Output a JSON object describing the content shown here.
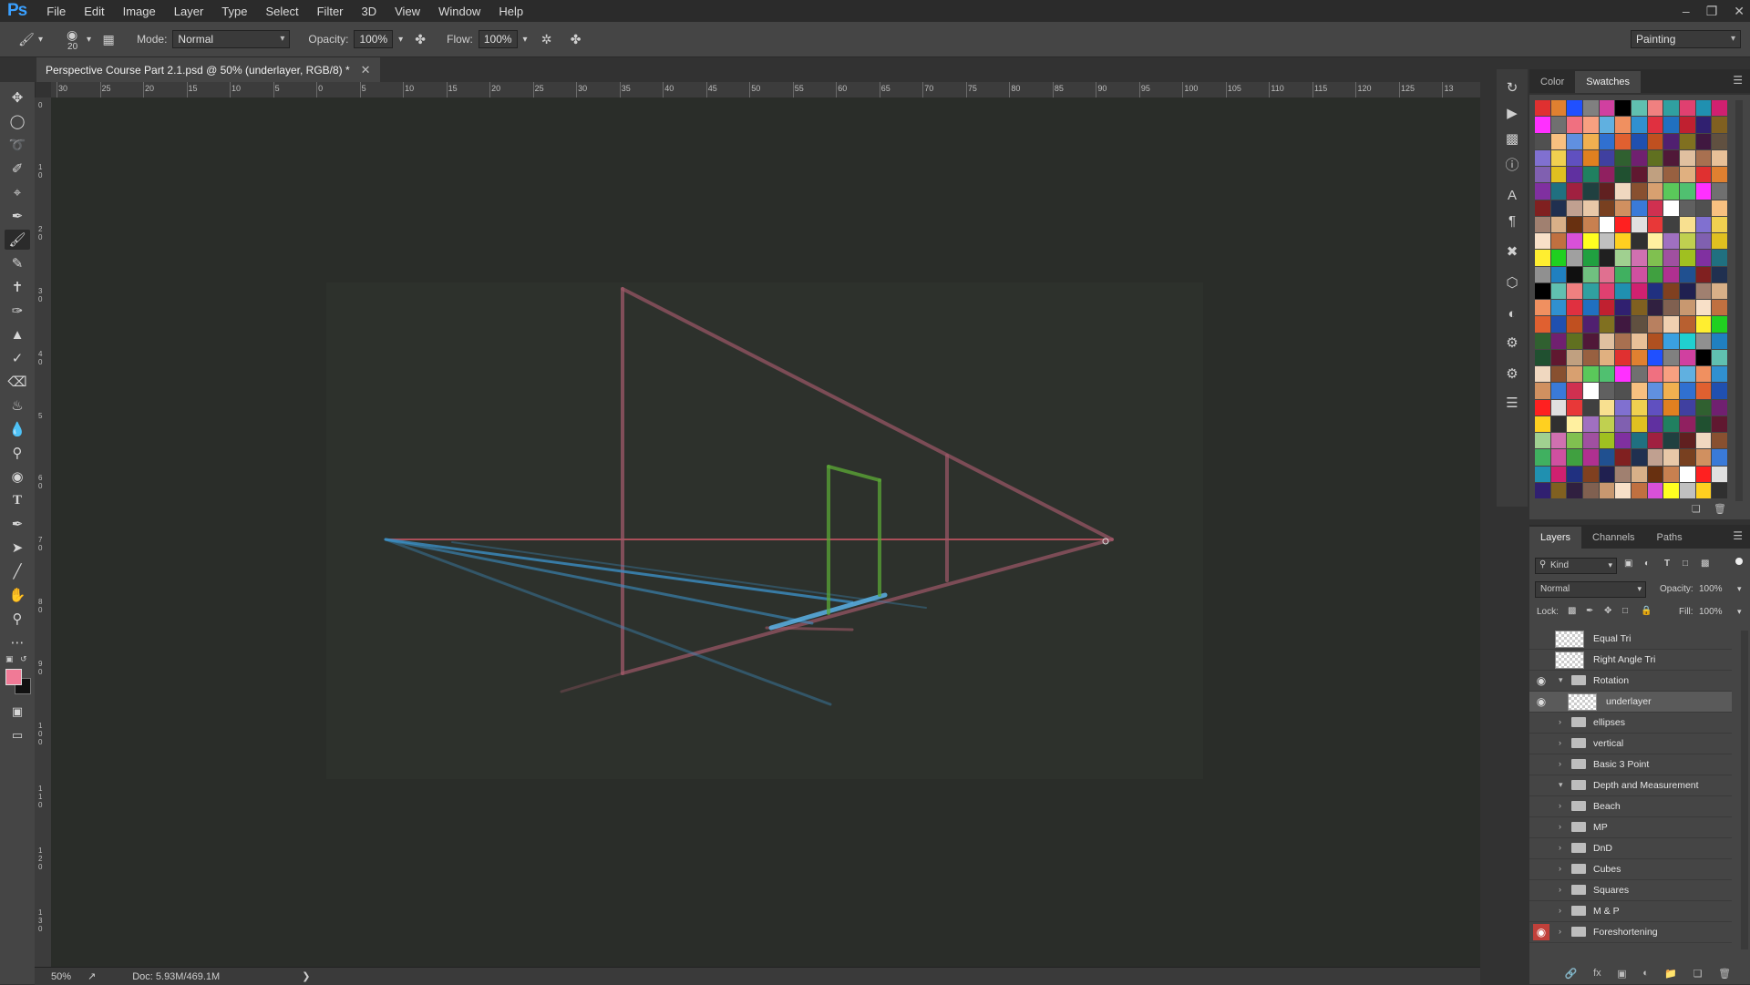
{
  "app": {
    "logo": "Ps"
  },
  "menu": [
    "File",
    "Edit",
    "Image",
    "Layer",
    "Type",
    "Select",
    "Filter",
    "3D",
    "View",
    "Window",
    "Help"
  ],
  "options_bar": {
    "brush_size": "20",
    "mode_label": "Mode:",
    "mode_value": "Normal",
    "opacity_label": "Opacity:",
    "opacity_value": "100%",
    "flow_label": "Flow:",
    "flow_value": "100%",
    "workspace": "Painting"
  },
  "document_tab": {
    "title": "Perspective Course Part 2.1.psd @ 50% (underlayer, RGB/8) *"
  },
  "ruler": {
    "h_labels": [
      "30",
      "25",
      "20",
      "15",
      "10",
      "5",
      "0",
      "5",
      "10",
      "15",
      "20",
      "25",
      "30",
      "35",
      "40",
      "45",
      "50",
      "55",
      "60",
      "65",
      "70",
      "75",
      "80",
      "85",
      "90",
      "95",
      "100",
      "105",
      "110",
      "115",
      "120",
      "125",
      "13"
    ],
    "v_labels": [
      "0",
      "1 0",
      "2 0",
      "3 0",
      "4 0",
      "5",
      "6 0",
      "7 0",
      "8 0",
      "9 0",
      "1 0 0",
      "1 1 0",
      "1 2 0",
      "1 3 0"
    ]
  },
  "status_bar": {
    "zoom": "50%",
    "doc_info": "Doc: 5.93M/469.1M"
  },
  "swatch_panel": {
    "tabs": [
      "Color",
      "Swatches"
    ],
    "active_tab": "Swatches"
  },
  "layers_panel": {
    "tabs": [
      "Layers",
      "Channels",
      "Paths"
    ],
    "active_tab": "Layers",
    "filter_kind": "Kind",
    "blend_mode": "Normal",
    "opacity_label": "Opacity:",
    "opacity_value": "100%",
    "lock_label": "Lock:",
    "fill_label": "Fill:",
    "fill_value": "100%",
    "layers": [
      {
        "name": "Equal Tri",
        "type": "layer",
        "visible": false,
        "indent": 0
      },
      {
        "name": "Right Angle Tri",
        "type": "layer",
        "visible": false,
        "indent": 0
      },
      {
        "name": "Rotation",
        "type": "group",
        "visible": true,
        "open": true,
        "indent": 0
      },
      {
        "name": "underlayer",
        "type": "layer",
        "visible": true,
        "indent": 1,
        "selected": true
      },
      {
        "name": "ellipses",
        "type": "group",
        "visible": false,
        "indent": 0
      },
      {
        "name": "vertical",
        "type": "group",
        "visible": false,
        "indent": 0
      },
      {
        "name": "Basic 3 Point",
        "type": "group",
        "visible": false,
        "indent": 0
      },
      {
        "name": "Depth and Measurement",
        "type": "group",
        "visible": false,
        "open": true,
        "indent": 0
      },
      {
        "name": "Beach",
        "type": "group",
        "visible": false,
        "indent": 0
      },
      {
        "name": "MP",
        "type": "group",
        "visible": false,
        "indent": 0
      },
      {
        "name": "DnD",
        "type": "group",
        "visible": false,
        "indent": 0
      },
      {
        "name": "Cubes",
        "type": "group",
        "visible": false,
        "indent": 0
      },
      {
        "name": "Squares",
        "type": "group",
        "visible": false,
        "indent": 0
      },
      {
        "name": "M & P",
        "type": "group",
        "visible": false,
        "indent": 0
      },
      {
        "name": "Foreshortening",
        "type": "group",
        "visible": true,
        "indent": 0,
        "eye_highlight": true
      }
    ]
  },
  "colors": {
    "foreground": "#f07a96",
    "background": "#111111",
    "line_red": "#b8535e",
    "line_pink": "#9e5868",
    "line_blue": "#3b8fc4",
    "line_green": "#5aa536"
  },
  "tools": [
    "move-tool",
    "marquee-tool",
    "lasso-tool",
    "quick-select-tool",
    "crop-tool",
    "eyedropper-tool",
    "brush-tool",
    "pencil-tool",
    "healing-tool",
    "mixer-brush-tool",
    "stamp-tool",
    "history-brush-tool",
    "eraser-tool",
    "paint-bucket-tool",
    "blur-tool",
    "dodge-tool",
    "sponge-tool",
    "type-tool",
    "pen-tool",
    "path-select-tool",
    "line-tool",
    "hand-tool",
    "zoom-tool",
    "more-tools"
  ]
}
